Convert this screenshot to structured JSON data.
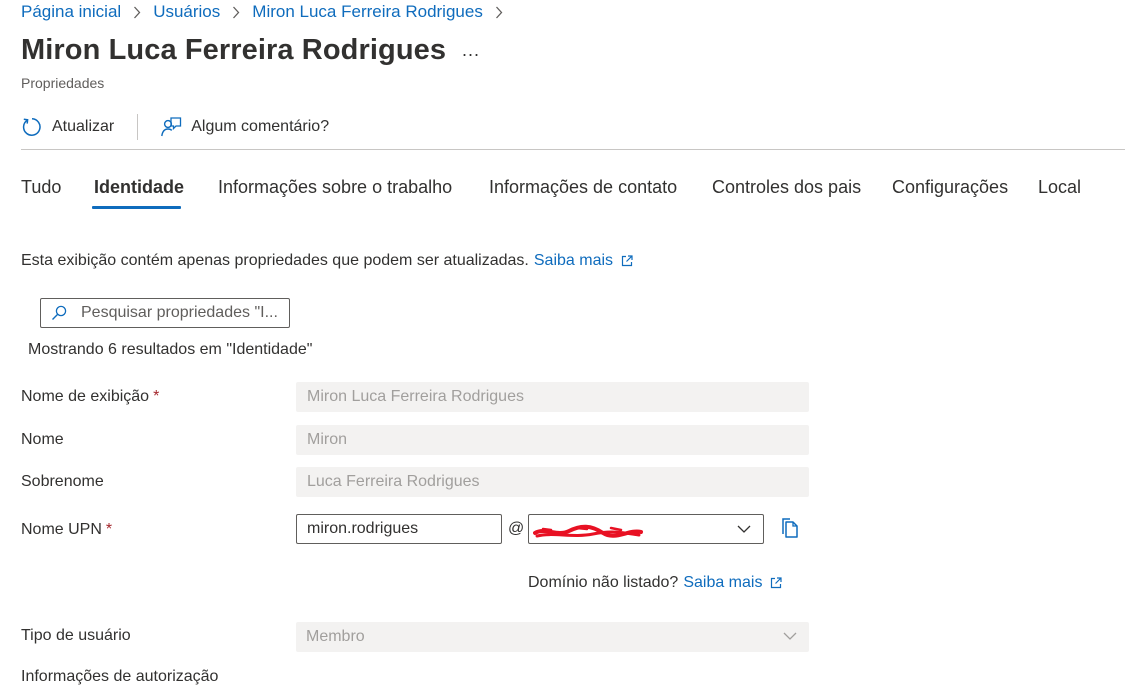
{
  "breadcrumb": {
    "items": [
      "Página inicial",
      "Usuários",
      "Miron Luca Ferreira Rodrigues"
    ]
  },
  "header": {
    "title": "Miron Luca Ferreira Rodrigues",
    "more": "...",
    "subtitle": "Propriedades"
  },
  "toolbar": {
    "refresh_label": "Atualizar",
    "refresh_icon": "refresh-icon",
    "feedback_label": "Algum comentário?",
    "feedback_icon": "feedback-icon"
  },
  "tabs": {
    "items": [
      "Tudo",
      "Identidade",
      "Informações sobre o trabalho",
      "Informações de contato",
      "Controles dos pais",
      "Configurações",
      "Local"
    ],
    "active": "Identidade"
  },
  "info": {
    "text": "Esta exibição contém apenas propriedades que podem ser atualizadas.",
    "link": "Saiba mais"
  },
  "search": {
    "placeholder": "Pesquisar propriedades \"I..."
  },
  "results": {
    "text": "Mostrando 6 resultados em \"Identidade\""
  },
  "fields": {
    "display_name": {
      "label": "Nome de exibição",
      "required": "*",
      "value": "Miron Luca Ferreira Rodrigues"
    },
    "first_name": {
      "label": "Nome",
      "value": "Miron"
    },
    "last_name": {
      "label": "Sobrenome",
      "value": "Luca Ferreira Rodrigues"
    },
    "upn": {
      "label": "Nome UPN",
      "required": "*",
      "value": "miron.rodrigues",
      "at": "@"
    },
    "domain_note": {
      "text": "Domínio não listado?",
      "link": "Saiba mais"
    },
    "user_type": {
      "label": "Tipo de usuário",
      "value": "Membro"
    },
    "authorization": {
      "label": "Informações de autorização"
    }
  },
  "colors": {
    "accent": "#0f6cbd",
    "text": "#323130",
    "disabled_bg": "#f3f2f1",
    "required": "#a4262c",
    "redaction": "#e81123"
  }
}
